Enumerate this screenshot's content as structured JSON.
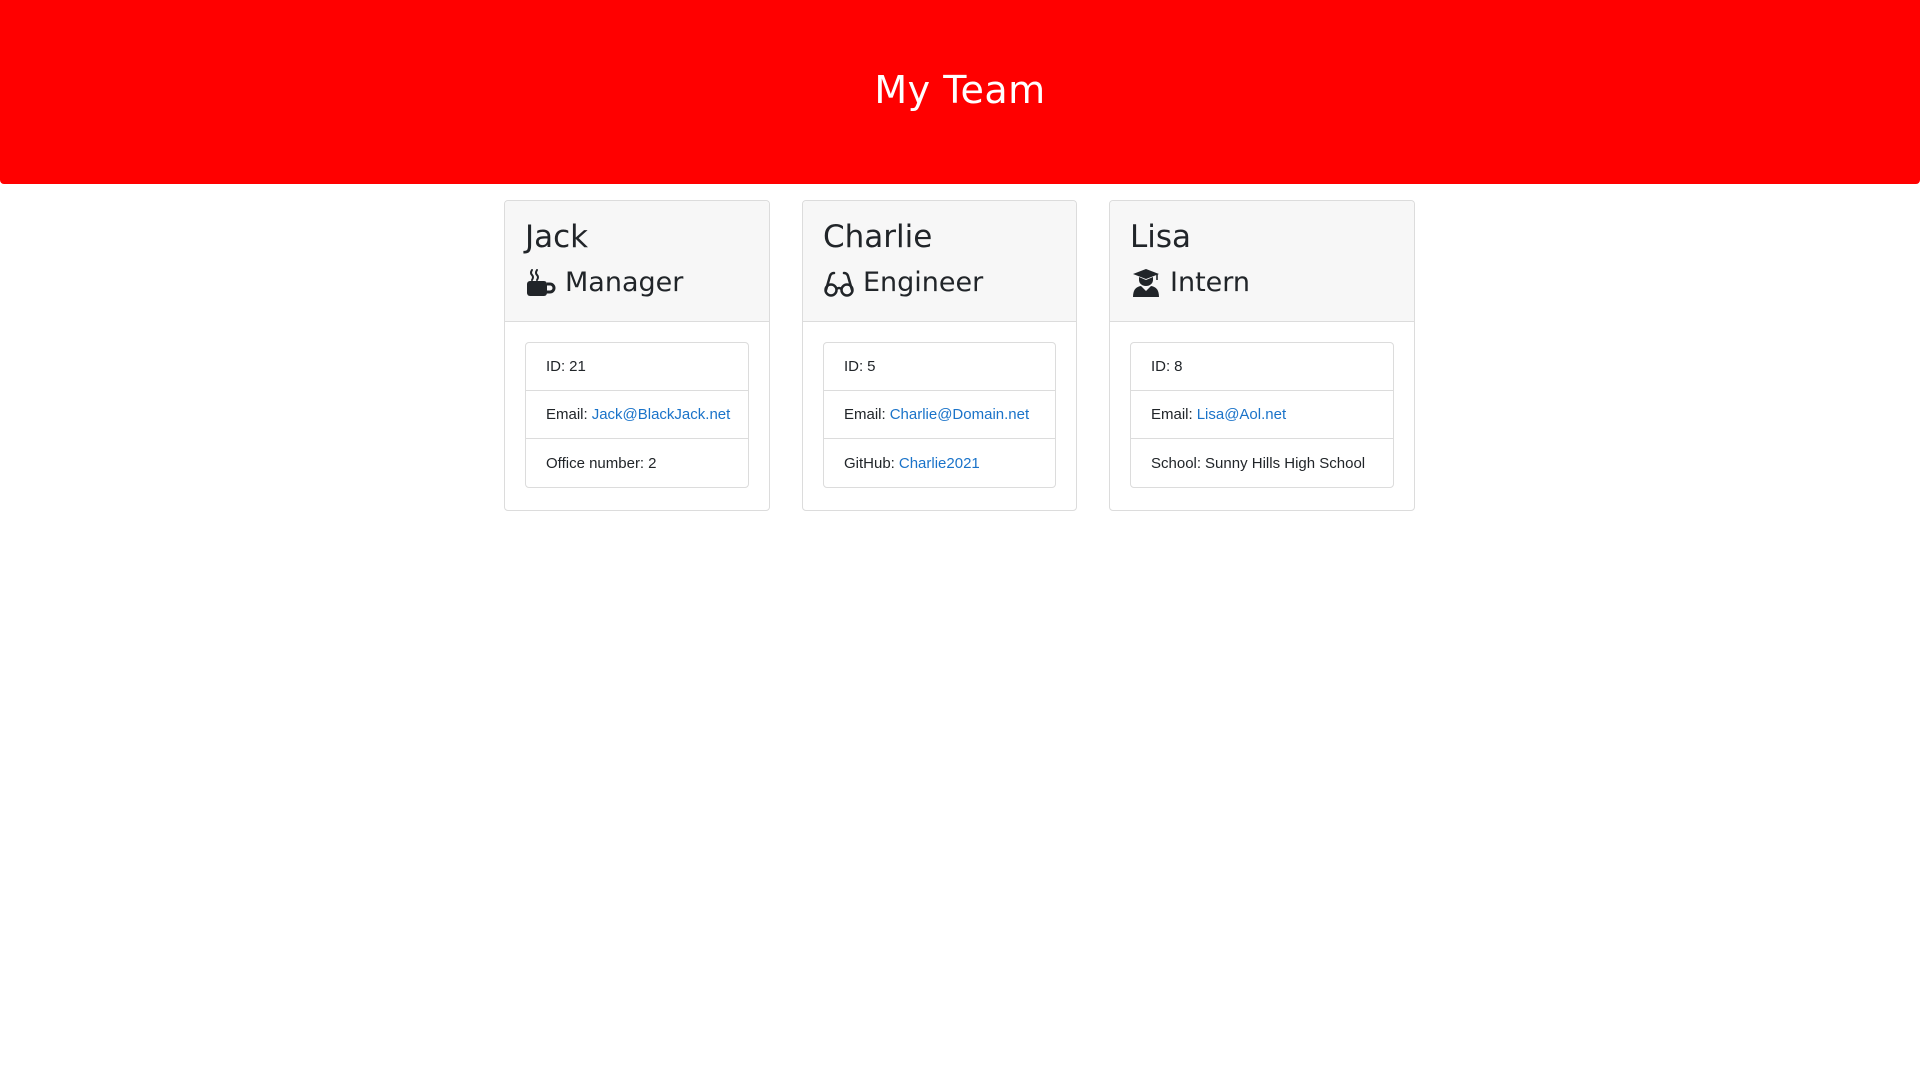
{
  "header": {
    "title": "My Team"
  },
  "employees": [
    {
      "name": "Jack",
      "role": "Manager",
      "role_icon": "coffee-mug-icon",
      "id_label": "ID:",
      "id": "21",
      "email_label": "Email:",
      "email": "Jack@BlackJack.net",
      "extra_label": "Office number:",
      "extra_value": "2"
    },
    {
      "name": "Charlie",
      "role": "Engineer",
      "role_icon": "glasses-icon",
      "id_label": "ID:",
      "id": "5",
      "email_label": "Email:",
      "email": "Charlie@Domain.net",
      "extra_label": "GitHub:",
      "extra_value": "Charlie2021"
    },
    {
      "name": "Lisa",
      "role": "Intern",
      "role_icon": "graduate-icon",
      "id_label": "ID:",
      "id": "8",
      "email_label": "Email:",
      "email": "Lisa@Aol.net",
      "extra_label": "School:",
      "extra_value": "Sunny Hills High School"
    }
  ],
  "colors": {
    "header_bg": "#ff0000",
    "link": "#1a73c9"
  }
}
